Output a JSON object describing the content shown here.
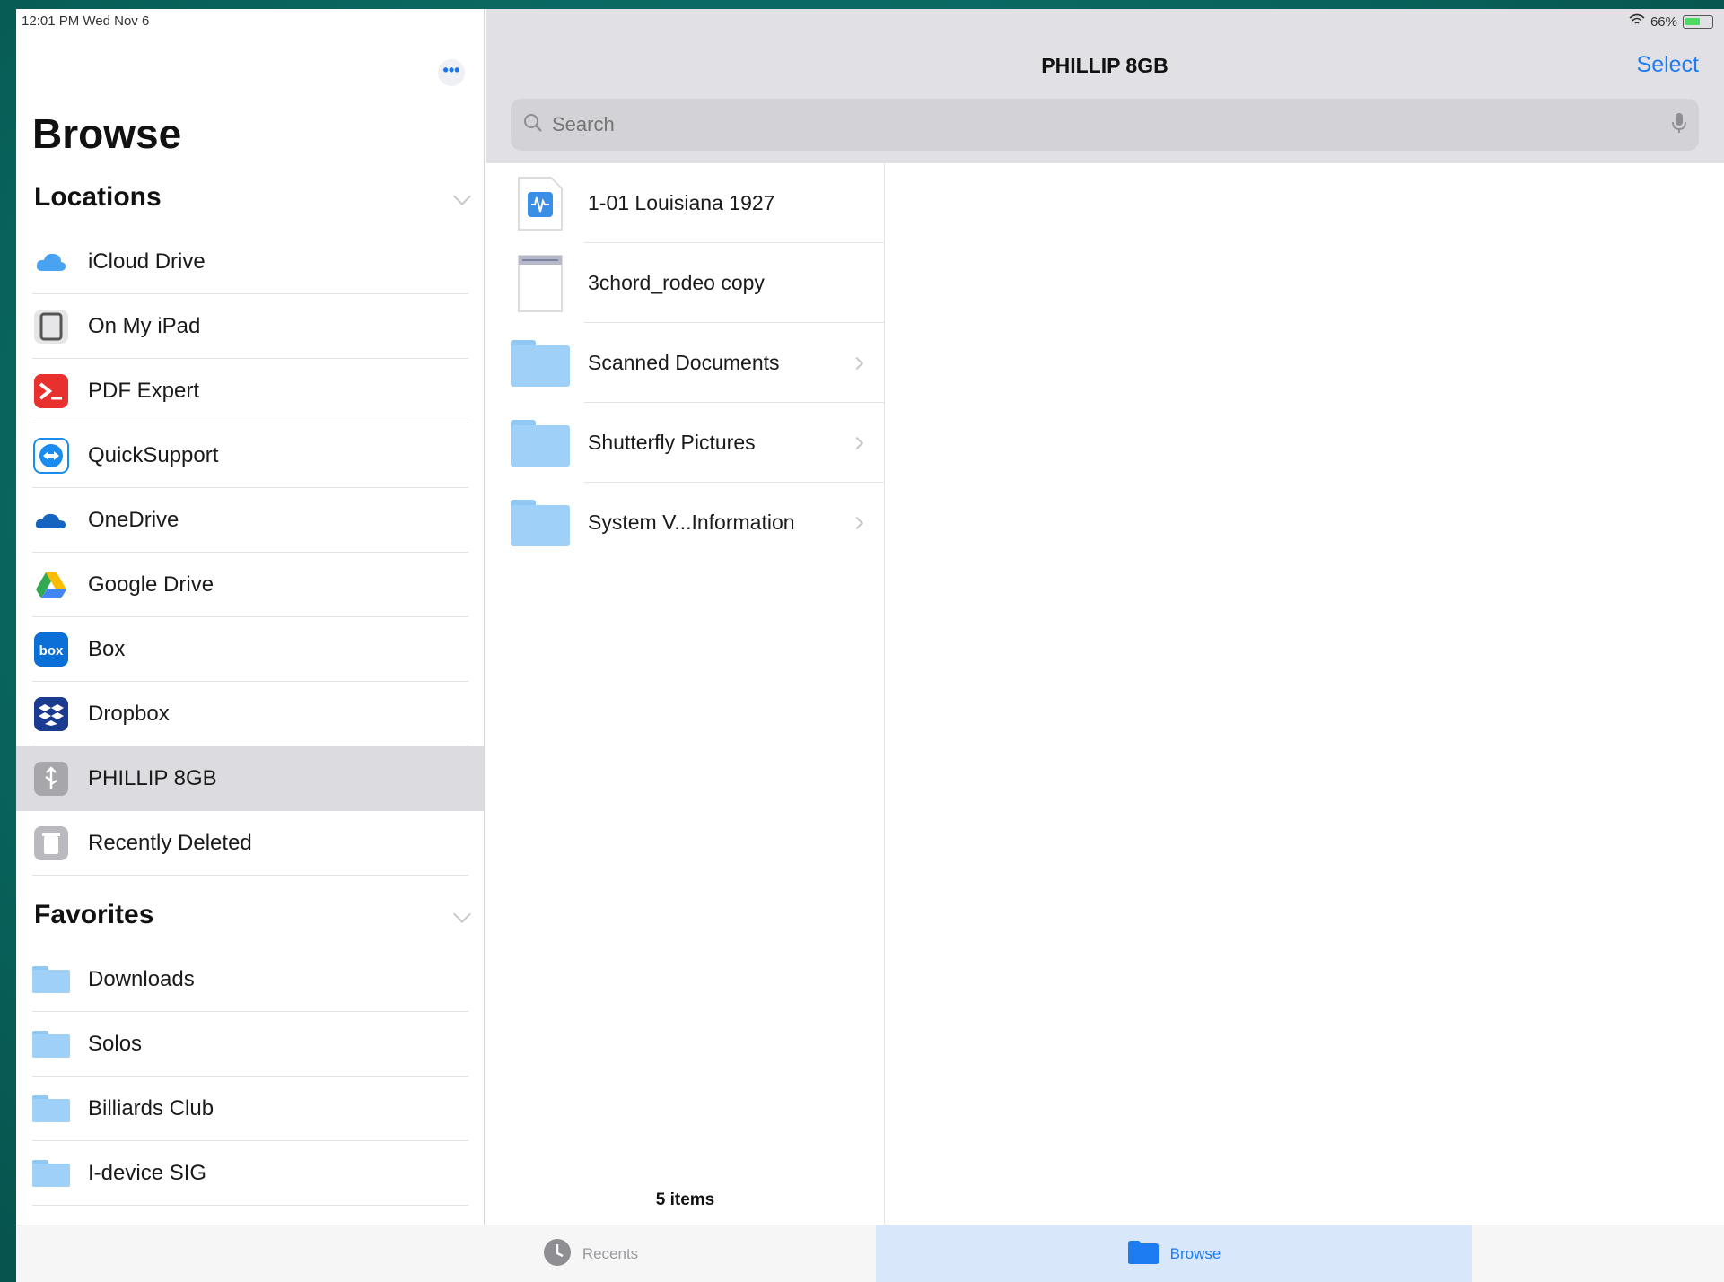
{
  "status_bar": {
    "time": "12:01 PM   Wed Nov 6",
    "battery": "66%"
  },
  "sidebar": {
    "title": "Browse",
    "more_label": "•••",
    "locations_header": "Locations",
    "locations": [
      {
        "label": "iCloud Drive",
        "icon": "icloud-icon"
      },
      {
        "label": "On My iPad",
        "icon": "ipad-icon"
      },
      {
        "label": "PDF Expert",
        "icon": "pdf-expert-icon"
      },
      {
        "label": "QuickSupport",
        "icon": "quicksupport-icon"
      },
      {
        "label": "OneDrive",
        "icon": "onedrive-icon"
      },
      {
        "label": "Google Drive",
        "icon": "google-drive-icon"
      },
      {
        "label": "Box",
        "icon": "box-icon",
        "icon_text": "box"
      },
      {
        "label": "Dropbox",
        "icon": "dropbox-icon"
      },
      {
        "label": "PHILLIP 8GB",
        "icon": "usb-drive-icon",
        "selected": true
      },
      {
        "label": "Recently Deleted",
        "icon": "trash-icon"
      }
    ],
    "favorites_header": "Favorites",
    "favorites": [
      {
        "label": "Downloads",
        "icon": "folder-icon"
      },
      {
        "label": "Solos",
        "icon": "folder-icon"
      },
      {
        "label": "Billiards Club",
        "icon": "folder-icon"
      },
      {
        "label": "I-device SIG",
        "icon": "folder-icon"
      }
    ]
  },
  "header": {
    "title": "PHILLIP 8GB",
    "select_label": "Select",
    "search_placeholder": "Search"
  },
  "files": [
    {
      "name": "1-01 Louisiana 1927",
      "type": "audio-file",
      "icon": "audio-file-icon"
    },
    {
      "name": "3chord_rodeo copy",
      "type": "document",
      "icon": "document-icon"
    },
    {
      "name": "Scanned Documents",
      "type": "folder",
      "icon": "folder-icon"
    },
    {
      "name": "Shutterfly Pictures",
      "type": "folder",
      "icon": "folder-icon"
    },
    {
      "name": "System V...Information",
      "type": "folder",
      "icon": "folder-icon"
    }
  ],
  "items_count": "5 items",
  "tabbar": {
    "recents_label": "Recents",
    "browse_label": "Browse"
  },
  "colors": {
    "accent": "#1e7cf2",
    "selected_row": "#dcdce0",
    "header_bg": "#e1e1e5",
    "folder": "#9fd1f8"
  }
}
